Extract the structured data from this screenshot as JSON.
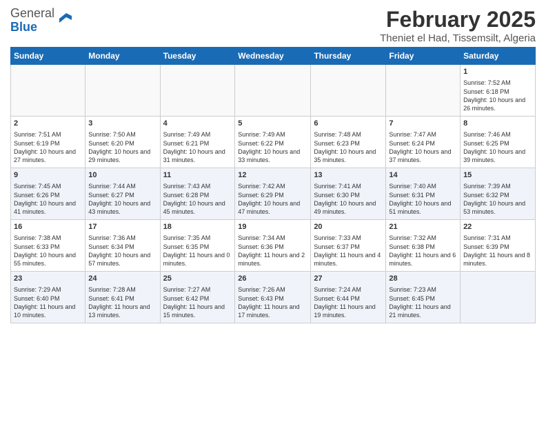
{
  "header": {
    "logo_general": "General",
    "logo_blue": "Blue",
    "title": "February 2025",
    "location": "Theniet el Had, Tissemsilt, Algeria"
  },
  "weekdays": [
    "Sunday",
    "Monday",
    "Tuesday",
    "Wednesday",
    "Thursday",
    "Friday",
    "Saturday"
  ],
  "weeks": [
    {
      "alt": false,
      "days": [
        {
          "num": "",
          "info": ""
        },
        {
          "num": "",
          "info": ""
        },
        {
          "num": "",
          "info": ""
        },
        {
          "num": "",
          "info": ""
        },
        {
          "num": "",
          "info": ""
        },
        {
          "num": "",
          "info": ""
        },
        {
          "num": "1",
          "info": "Sunrise: 7:52 AM\nSunset: 6:18 PM\nDaylight: 10 hours and 26 minutes."
        }
      ]
    },
    {
      "alt": false,
      "days": [
        {
          "num": "2",
          "info": "Sunrise: 7:51 AM\nSunset: 6:19 PM\nDaylight: 10 hours and 27 minutes."
        },
        {
          "num": "3",
          "info": "Sunrise: 7:50 AM\nSunset: 6:20 PM\nDaylight: 10 hours and 29 minutes."
        },
        {
          "num": "4",
          "info": "Sunrise: 7:49 AM\nSunset: 6:21 PM\nDaylight: 10 hours and 31 minutes."
        },
        {
          "num": "5",
          "info": "Sunrise: 7:49 AM\nSunset: 6:22 PM\nDaylight: 10 hours and 33 minutes."
        },
        {
          "num": "6",
          "info": "Sunrise: 7:48 AM\nSunset: 6:23 PM\nDaylight: 10 hours and 35 minutes."
        },
        {
          "num": "7",
          "info": "Sunrise: 7:47 AM\nSunset: 6:24 PM\nDaylight: 10 hours and 37 minutes."
        },
        {
          "num": "8",
          "info": "Sunrise: 7:46 AM\nSunset: 6:25 PM\nDaylight: 10 hours and 39 minutes."
        }
      ]
    },
    {
      "alt": true,
      "days": [
        {
          "num": "9",
          "info": "Sunrise: 7:45 AM\nSunset: 6:26 PM\nDaylight: 10 hours and 41 minutes."
        },
        {
          "num": "10",
          "info": "Sunrise: 7:44 AM\nSunset: 6:27 PM\nDaylight: 10 hours and 43 minutes."
        },
        {
          "num": "11",
          "info": "Sunrise: 7:43 AM\nSunset: 6:28 PM\nDaylight: 10 hours and 45 minutes."
        },
        {
          "num": "12",
          "info": "Sunrise: 7:42 AM\nSunset: 6:29 PM\nDaylight: 10 hours and 47 minutes."
        },
        {
          "num": "13",
          "info": "Sunrise: 7:41 AM\nSunset: 6:30 PM\nDaylight: 10 hours and 49 minutes."
        },
        {
          "num": "14",
          "info": "Sunrise: 7:40 AM\nSunset: 6:31 PM\nDaylight: 10 hours and 51 minutes."
        },
        {
          "num": "15",
          "info": "Sunrise: 7:39 AM\nSunset: 6:32 PM\nDaylight: 10 hours and 53 minutes."
        }
      ]
    },
    {
      "alt": false,
      "days": [
        {
          "num": "16",
          "info": "Sunrise: 7:38 AM\nSunset: 6:33 PM\nDaylight: 10 hours and 55 minutes."
        },
        {
          "num": "17",
          "info": "Sunrise: 7:36 AM\nSunset: 6:34 PM\nDaylight: 10 hours and 57 minutes."
        },
        {
          "num": "18",
          "info": "Sunrise: 7:35 AM\nSunset: 6:35 PM\nDaylight: 11 hours and 0 minutes."
        },
        {
          "num": "19",
          "info": "Sunrise: 7:34 AM\nSunset: 6:36 PM\nDaylight: 11 hours and 2 minutes."
        },
        {
          "num": "20",
          "info": "Sunrise: 7:33 AM\nSunset: 6:37 PM\nDaylight: 11 hours and 4 minutes."
        },
        {
          "num": "21",
          "info": "Sunrise: 7:32 AM\nSunset: 6:38 PM\nDaylight: 11 hours and 6 minutes."
        },
        {
          "num": "22",
          "info": "Sunrise: 7:31 AM\nSunset: 6:39 PM\nDaylight: 11 hours and 8 minutes."
        }
      ]
    },
    {
      "alt": true,
      "days": [
        {
          "num": "23",
          "info": "Sunrise: 7:29 AM\nSunset: 6:40 PM\nDaylight: 11 hours and 10 minutes."
        },
        {
          "num": "24",
          "info": "Sunrise: 7:28 AM\nSunset: 6:41 PM\nDaylight: 11 hours and 13 minutes."
        },
        {
          "num": "25",
          "info": "Sunrise: 7:27 AM\nSunset: 6:42 PM\nDaylight: 11 hours and 15 minutes."
        },
        {
          "num": "26",
          "info": "Sunrise: 7:26 AM\nSunset: 6:43 PM\nDaylight: 11 hours and 17 minutes."
        },
        {
          "num": "27",
          "info": "Sunrise: 7:24 AM\nSunset: 6:44 PM\nDaylight: 11 hours and 19 minutes."
        },
        {
          "num": "28",
          "info": "Sunrise: 7:23 AM\nSunset: 6:45 PM\nDaylight: 11 hours and 21 minutes."
        },
        {
          "num": "",
          "info": ""
        }
      ]
    }
  ]
}
